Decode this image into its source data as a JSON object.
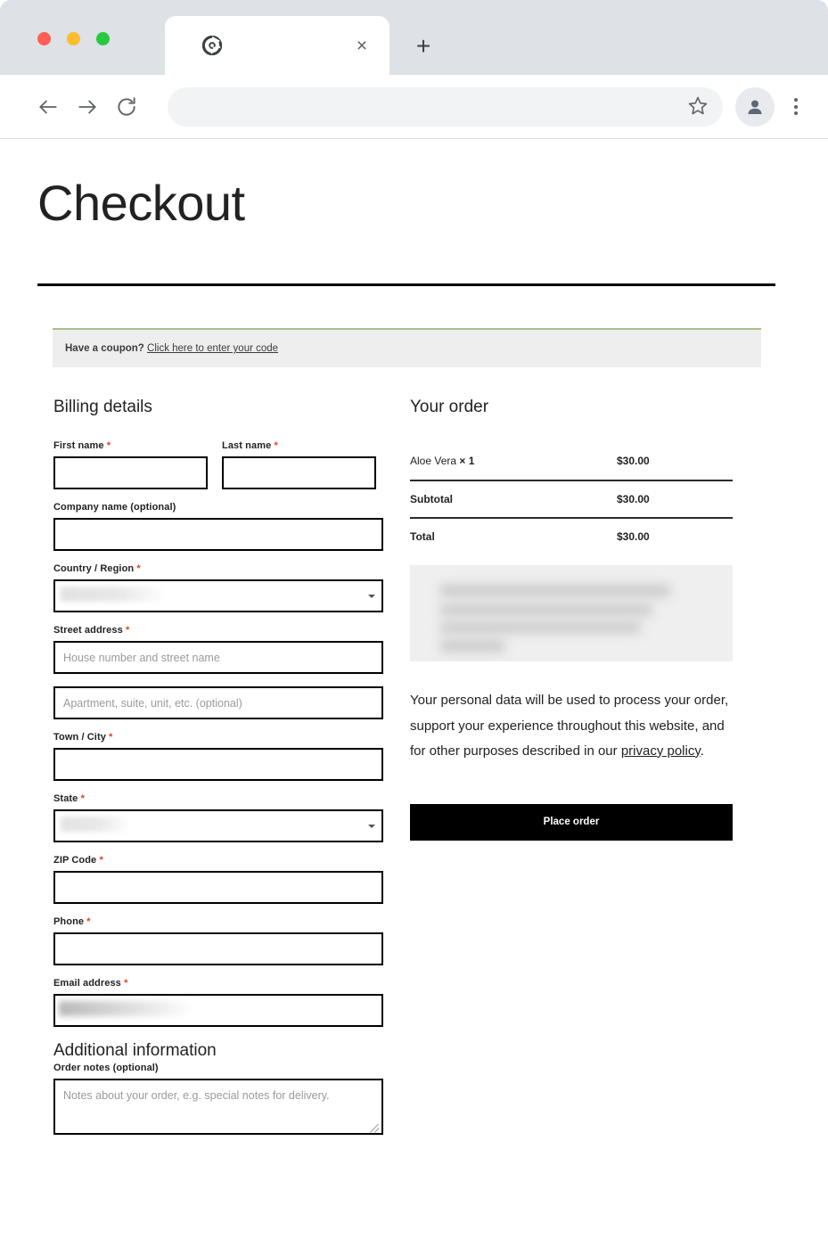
{
  "browser": {
    "traffic_lights": [
      {
        "name": "close",
        "color": "#ff5f56"
      },
      {
        "name": "minimize",
        "color": "#ffbd2e"
      },
      {
        "name": "zoom",
        "color": "#27c93f"
      }
    ],
    "tab": {
      "title": "",
      "favicon": "chrome-favicon",
      "close_label": "×"
    },
    "new_tab_label": "+",
    "nav": {
      "back": "back-icon",
      "forward": "forward-icon",
      "reload": "reload-icon",
      "url_value": "",
      "url_placeholder": "",
      "bookmark": "star-icon",
      "profile": "avatar-icon",
      "menu": "kebab-icon"
    }
  },
  "page": {
    "title": "Checkout",
    "coupon": {
      "prompt": "Have a coupon?",
      "link": "Click here to enter your code"
    },
    "billing": {
      "heading": "Billing details",
      "first_name": {
        "label": "First name",
        "required": "*",
        "value": "",
        "placeholder": ""
      },
      "last_name": {
        "label": "Last name",
        "required": "*",
        "value": "",
        "placeholder": ""
      },
      "company": {
        "label": "Company name (optional)",
        "value": "",
        "placeholder": ""
      },
      "country": {
        "label": "Country / Region",
        "required": "*",
        "value": "",
        "redacted": true
      },
      "street": {
        "label": "Street address",
        "required": "*",
        "value": "",
        "placeholder": "House number and street name"
      },
      "street2": {
        "value": "",
        "placeholder": "Apartment, suite, unit, etc. (optional)"
      },
      "city": {
        "label": "Town / City",
        "required": "*",
        "value": "",
        "placeholder": ""
      },
      "state": {
        "label": "State",
        "required": "*",
        "value": "",
        "redacted": true
      },
      "zip": {
        "label": "ZIP Code",
        "required": "*",
        "value": "",
        "placeholder": ""
      },
      "phone": {
        "label": "Phone",
        "required": "*",
        "value": "",
        "placeholder": ""
      },
      "email": {
        "label": "Email address",
        "required": "*",
        "value": "",
        "redacted": true
      }
    },
    "additional": {
      "heading": "Additional information",
      "notes": {
        "label": "Order notes (optional)",
        "value": "",
        "placeholder": "Notes about your order, e.g. special notes for delivery."
      }
    },
    "order": {
      "heading": "Your order",
      "items": [
        {
          "name": "Aloe Vera",
          "qty": "× 1",
          "price": "$30.00"
        }
      ],
      "subtotal": {
        "label": "Subtotal",
        "value": "$30.00"
      },
      "total": {
        "label": "Total",
        "value": "$30.00"
      },
      "payment_methods_redacted": true,
      "privacy_text_before": "Your personal data will be used to process your order, support your experience throughout this website, and for other purposes described in our ",
      "privacy_link": "privacy policy",
      "privacy_text_after": ".",
      "place_order_label": "Place order"
    }
  },
  "colors": {
    "accent_required": "#e2401c",
    "button_bg": "#000000",
    "coupon_border": "#a8c08b",
    "coupon_bg": "#eeeeee"
  }
}
